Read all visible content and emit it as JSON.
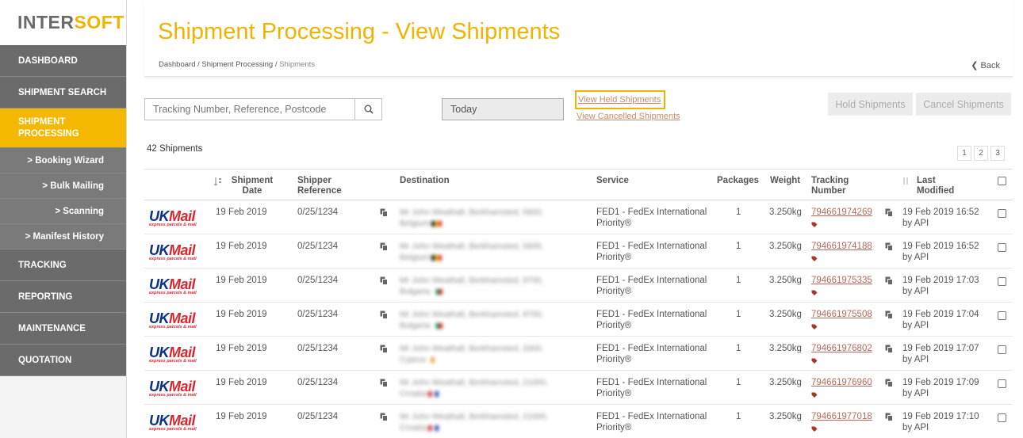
{
  "logo": {
    "part1": "INTER",
    "part2": "SOFT"
  },
  "sidebar": {
    "items": [
      {
        "label": "DASHBOARD",
        "kind": "main"
      },
      {
        "label": "SHIPMENT SEARCH",
        "kind": "main"
      },
      {
        "label": "SHIPMENT PROCESSING",
        "kind": "active"
      },
      {
        "label": "> Booking Wizard",
        "kind": "sub"
      },
      {
        "label": "> Bulk Mailing",
        "kind": "sub"
      },
      {
        "label": "> Scanning",
        "kind": "sub"
      },
      {
        "label": "> Manifest History",
        "kind": "sub"
      },
      {
        "label": "TRACKING",
        "kind": "main"
      },
      {
        "label": "REPORTING",
        "kind": "main"
      },
      {
        "label": "MAINTENANCE",
        "kind": "main"
      },
      {
        "label": "QUOTATION",
        "kind": "main"
      }
    ]
  },
  "header": {
    "title": "Shipment Processing - View Shipments",
    "breadcrumb": [
      "Dashboard",
      "Shipment Processing",
      "Shipments"
    ],
    "breadcrumb_sep": "/",
    "back_label": "Back"
  },
  "toolbar": {
    "search_placeholder": "Tracking Number, Reference, Postcode",
    "date_value": "Today",
    "held_link": "View Held Shipments",
    "cancelled_link": "View Cancelled Shipments",
    "hold_button": "Hold Shipments",
    "cancel_button": "Cancel Shipments"
  },
  "summary": {
    "count_text": "42 Shipments"
  },
  "pagination": {
    "pages": [
      "1",
      "2",
      "3"
    ]
  },
  "table": {
    "headers": {
      "shipment_date": "Shipment Date",
      "shipper_reference": "Shipper Reference",
      "destination": "Destination",
      "service": "Service",
      "packages": "Packages",
      "weight": "Weight",
      "tracking_number": "Tracking Number",
      "last_modified": "Last Modified"
    },
    "carrier_logo": {
      "uk": "UK",
      "mail": "Mail",
      "tagline": "express parcels & mail"
    },
    "rows": [
      {
        "date": "19 Feb 2019",
        "ref": "0/25/1234",
        "dest": "Mr John Weathall, Berkhamsted, 5800, Belgium",
        "service": "FED1 - FedEx International Priority®",
        "packages": "1",
        "weight": "3.250kg",
        "tracking": "794661974269",
        "modified": "19 Feb 2019 16:52",
        "by": "by API"
      },
      {
        "date": "19 Feb 2019",
        "ref": "0/25/1234",
        "dest": "Mr John Weathall, Berkhamsted, 5800, Belgium",
        "service": "FED1 - FedEx International Priority®",
        "packages": "1",
        "weight": "3.250kg",
        "tracking": "794661974188",
        "modified": "19 Feb 2019 16:52",
        "by": "by API"
      },
      {
        "date": "19 Feb 2019",
        "ref": "0/25/1234",
        "dest": "Mr John Weathall, Berkhamsted, 9700, Bulgaria",
        "service": "FED1 - FedEx International Priority®",
        "packages": "1",
        "weight": "3.250kg",
        "tracking": "794661975335",
        "modified": "19 Feb 2019 17:03",
        "by": "by API"
      },
      {
        "date": "19 Feb 2019",
        "ref": "0/25/1234",
        "dest": "Mr John Weathall, Berkhamsted, 9700, Bulgaria",
        "service": "FED1 - FedEx International Priority®",
        "packages": "1",
        "weight": "3.250kg",
        "tracking": "794661975508",
        "modified": "19 Feb 2019 17:04",
        "by": "by API"
      },
      {
        "date": "19 Feb 2019",
        "ref": "0/25/1234",
        "dest": "Mr John Weathall, Berkhamsted, 3300, Cyprus",
        "service": "FED1 - FedEx International Priority®",
        "packages": "1",
        "weight": "3.250kg",
        "tracking": "794661976802",
        "modified": "19 Feb 2019 17:07",
        "by": "by API"
      },
      {
        "date": "19 Feb 2019",
        "ref": "0/25/1234",
        "dest": "Mr John Weathall, Berkhamsted, 21000, Croatia",
        "service": "FED1 - FedEx International Priority®",
        "packages": "1",
        "weight": "3.250kg",
        "tracking": "794661976960",
        "modified": "19 Feb 2019 17:09",
        "by": "by API"
      },
      {
        "date": "19 Feb 2019",
        "ref": "0/25/1234",
        "dest": "Mr John Weathall, Berkhamsted, 21000, Croatia",
        "service": "FED1 - FedEx International Priority®",
        "packages": "1",
        "weight": "3.250kg",
        "tracking": "794661977018",
        "modified": "19 Feb 2019 17:10",
        "by": "by API"
      }
    ]
  },
  "colors": {
    "accent": "#f0b400",
    "sidebar": "#6b6b6b",
    "link": "#b5695b"
  }
}
